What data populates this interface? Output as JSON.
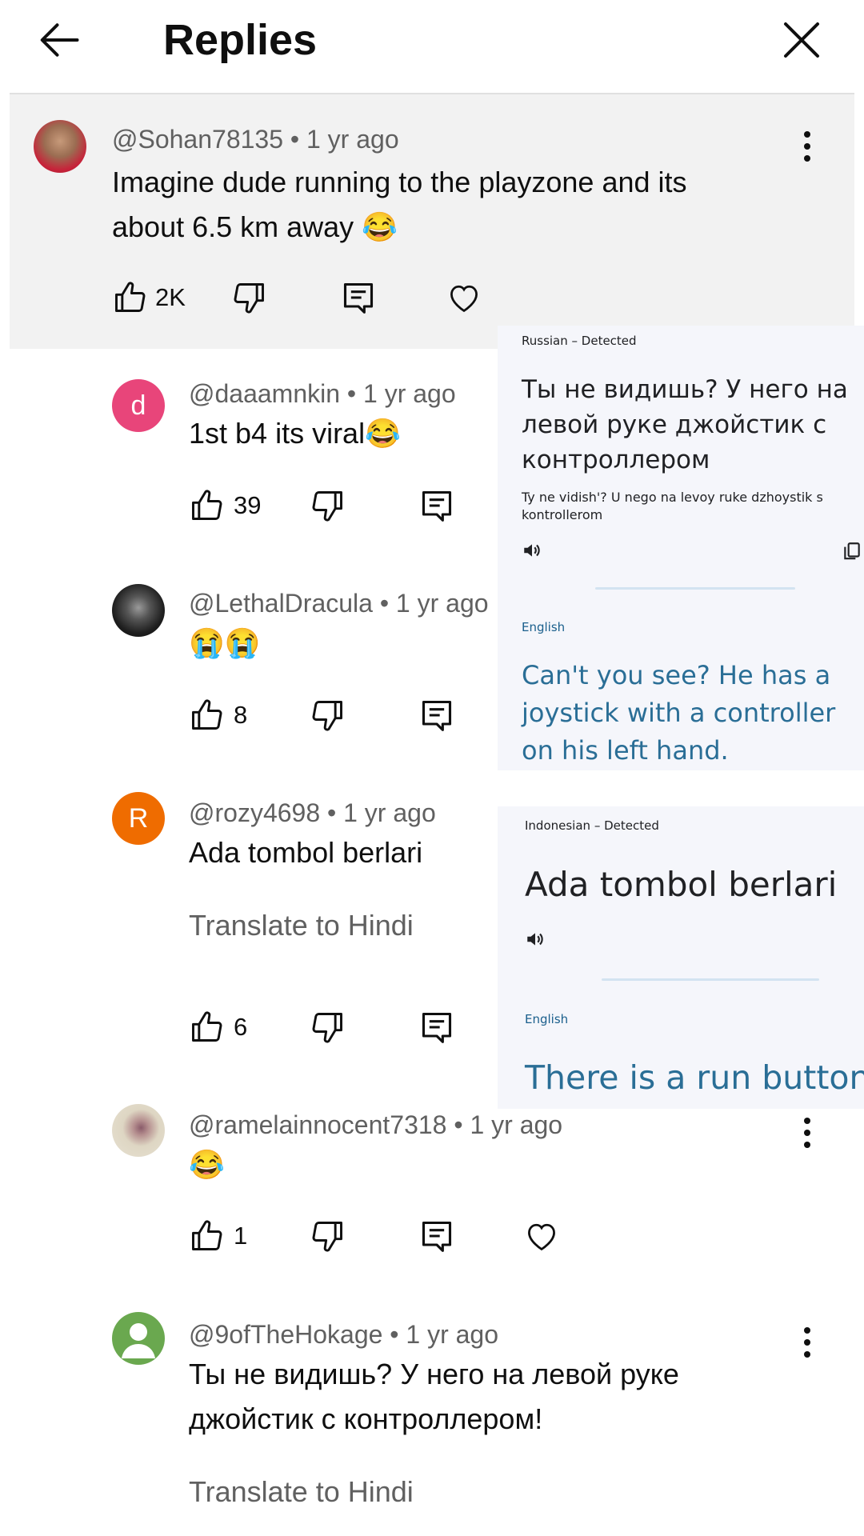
{
  "header": {
    "title": "Replies"
  },
  "top_comment": {
    "handle": "@Sohan78135",
    "age": "1 yr ago",
    "text": "Imagine dude running to the playzone and its about 6.5 km away 😂",
    "likes": "2K"
  },
  "replies": [
    {
      "handle": "@daaamnkin",
      "age": "1 yr ago",
      "text": "1st b4 its viral😂",
      "likes": "39",
      "avatar_letter": "d",
      "avatar_color": "#e8457a"
    },
    {
      "handle": "@LethalDracula",
      "age": "1 yr ago",
      "text": "😭😭",
      "likes": "8",
      "avatar_color": "#2b2b2b"
    },
    {
      "handle": "@rozy4698",
      "age": "1 yr ago",
      "text": "Ada tombol berlari",
      "translate": "Translate to Hindi",
      "likes": "6",
      "avatar_letter": "R",
      "avatar_color": "#ef6c00"
    },
    {
      "handle": "@ramelainnocent7318",
      "age": "1 yr ago",
      "text": "😂",
      "likes": "1",
      "avatar_color": "#d8cdb5"
    },
    {
      "handle": "@9ofTheHokage",
      "age": "1 yr ago",
      "text": "Ты не видишь? У него на левой руке джойстик с контроллером!",
      "translate": "Translate to Hindi",
      "avatar_color": "#6aa84f"
    }
  ],
  "translation_ru": {
    "detected": "Russian – Detected",
    "source": "Ты не видишь? У него на левой руке джойстик с контроллером",
    "transliteration": "Ty ne vidish'? U nego na levoy ruke dzhoystik s kontrollerom",
    "target_lang": "English",
    "result": "Can't you see? He has a joystick with a controller on his left hand."
  },
  "translation_id": {
    "detected": "Indonesian – Detected",
    "source": "Ada tombol berlari",
    "target_lang": "English",
    "result": "There is a run button"
  },
  "icons": [
    "back-arrow-icon",
    "close-icon",
    "more-vert-icon",
    "thumb-up-icon",
    "thumb-down-icon",
    "reply-icon",
    "heart-icon",
    "speaker-icon",
    "copy-icon"
  ]
}
